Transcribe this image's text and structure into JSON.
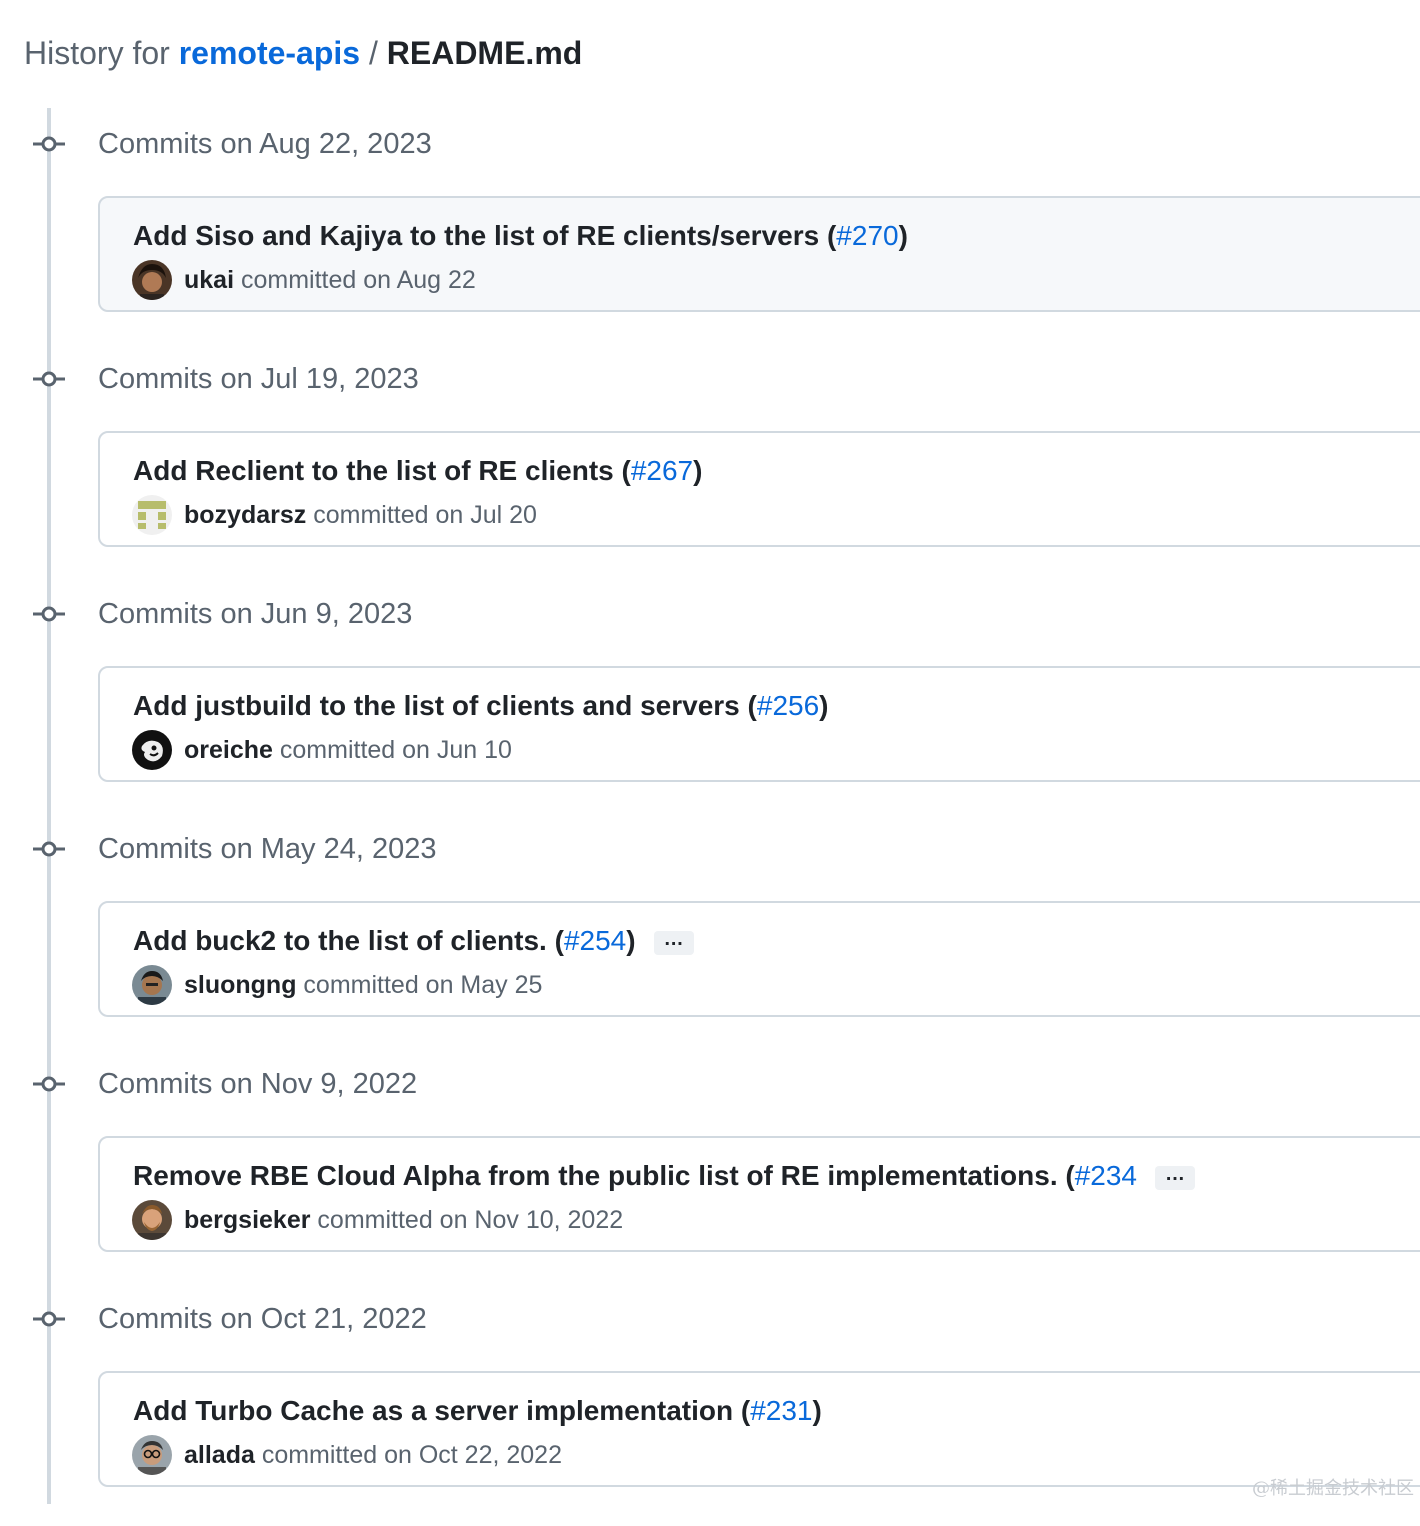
{
  "header": {
    "prefix": "History for ",
    "repo": "remote-apis",
    "separator": " / ",
    "file": "README.md"
  },
  "groups": [
    {
      "date": "Commits on Aug 22, 2023",
      "commit": {
        "title": "Add Siso and Kajiya to the list of RE clients/servers (",
        "pr": "#270",
        "close": ")",
        "has_ellipsis": false,
        "author": "ukai",
        "committed": " committed on Aug 22",
        "avatar": "avatar-photo-dark-hair"
      }
    },
    {
      "date": "Commits on Jul 19, 2023",
      "commit": {
        "title": "Add Reclient to the list of RE clients (",
        "pr": "#267",
        "close": ")",
        "has_ellipsis": false,
        "author": "bozydarsz",
        "committed": " committed on Jul 20",
        "avatar": "avatar-identicon-olive"
      }
    },
    {
      "date": "Commits on Jun 9, 2023",
      "commit": {
        "title": "Add justbuild to the list of clients and servers (",
        "pr": "#256",
        "close": ")",
        "has_ellipsis": false,
        "author": "oreiche",
        "committed": " committed on Jun 10",
        "avatar": "avatar-black-white"
      }
    },
    {
      "date": "Commits on May 24, 2023",
      "commit": {
        "title": "Add buck2 to the list of clients. (",
        "pr": "#254",
        "close": ")",
        "has_ellipsis": true,
        "ellipsis": "…",
        "author": "sluongng",
        "committed": " committed on May 25",
        "avatar": "avatar-photo-person"
      }
    },
    {
      "date": "Commits on Nov 9, 2022",
      "commit": {
        "title": "Remove RBE Cloud Alpha from the public list of RE implementations. (",
        "pr": "#234",
        "close": "",
        "has_ellipsis": true,
        "ellipsis": "…",
        "author": "bergsieker",
        "committed": " committed on Nov 10, 2022",
        "avatar": "avatar-photo-beard"
      }
    },
    {
      "date": "Commits on Oct 21, 2022",
      "commit": {
        "title": "Add Turbo Cache as a server implementation (",
        "pr": "#231",
        "close": ")",
        "has_ellipsis": false,
        "author": "allada",
        "committed": " committed on Oct 22, 2022",
        "avatar": "avatar-photo-glasses"
      }
    }
  ],
  "watermark": "@稀土掘金技术社区",
  "colors": {
    "link": "#0969da",
    "muted": "#59636e",
    "text": "#1f2328",
    "border": "#d1d9e0",
    "highlight_bg": "#f6f8fa"
  }
}
